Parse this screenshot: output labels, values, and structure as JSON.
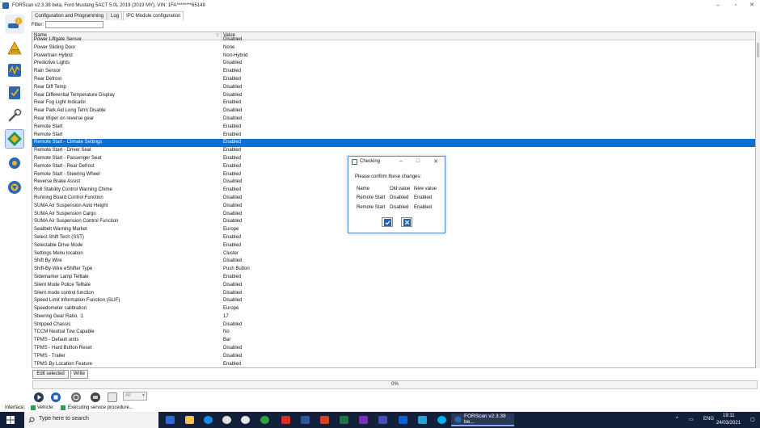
{
  "window": {
    "title": "FORScan v2.3.38 beta, Ford Mustang 5ACT 5.0L 2019 (2019 MY), VIN: 1FA********65149",
    "controls": [
      "–",
      "▫",
      "✕"
    ]
  },
  "sidebar": {
    "buttons": [
      {
        "name": "vehicle-info",
        "color": "#2a67b1"
      },
      {
        "name": "dtc",
        "color": "#e8a21a"
      },
      {
        "name": "oscilloscope",
        "color": "#2a67b1"
      },
      {
        "name": "checklist",
        "color": "#2a67b1"
      },
      {
        "name": "service-wrench",
        "color": "#555555"
      },
      {
        "name": "configuration",
        "color": "#1d9a5b"
      },
      {
        "name": "settings",
        "color": "#2a67b1"
      },
      {
        "name": "about",
        "color": "#2a67b1"
      }
    ]
  },
  "tabs": [
    {
      "label": "Configuration and Programming",
      "active": false
    },
    {
      "label": "Log",
      "active": false
    },
    {
      "label": "IPC Module configuration",
      "active": true
    }
  ],
  "filter": {
    "label": "Filter:",
    "value": ""
  },
  "grid": {
    "columns": [
      "Name",
      "Value"
    ],
    "rows": [
      {
        "name": "Power Liftgate Sensor",
        "value": "Disabled"
      },
      {
        "name": "Power Sliding Door",
        "value": "None"
      },
      {
        "name": "Powertrain Hybrid",
        "value": "Non-Hybrid"
      },
      {
        "name": "Predictive Lights",
        "value": "Disabled"
      },
      {
        "name": "Rain Sensor",
        "value": "Enabled"
      },
      {
        "name": "Rear Defrost",
        "value": "Enabled"
      },
      {
        "name": "Rear Diff Temp",
        "value": "Disabled"
      },
      {
        "name": "Rear Differential Temperature Display",
        "value": "Disabled"
      },
      {
        "name": "Rear Fog Light Indicator",
        "value": "Enabled"
      },
      {
        "name": "Rear Park Aid Long Term Disable",
        "value": "Disabled"
      },
      {
        "name": "Rear Wiper on reverse gear",
        "value": "Disabled"
      },
      {
        "name": "Remote Start",
        "value": "Enabled"
      },
      {
        "name": "Remote Start",
        "value": "Enabled"
      },
      {
        "name": "Remote Start - Climate Settings",
        "value": "Enabled",
        "selected": true
      },
      {
        "name": "Remote Start - Driver Seat",
        "value": "Enabled"
      },
      {
        "name": "Remote Start - Passenger Seat",
        "value": "Enabled"
      },
      {
        "name": "Remote Start - Rear Defrost",
        "value": "Enabled"
      },
      {
        "name": "Remote Start - Steering Wheel",
        "value": "Enabled"
      },
      {
        "name": "Reverse Brake Assist",
        "value": "Disabled"
      },
      {
        "name": "Roll Stability Control Warning Chime",
        "value": "Enabled"
      },
      {
        "name": "Running Board Control Function",
        "value": "Disabled"
      },
      {
        "name": "SUMA Air Suspension Auto Height",
        "value": "Disabled"
      },
      {
        "name": "SUMA Air Suspension Cargo",
        "value": "Disabled"
      },
      {
        "name": "SUMA Air Suspension Control Function",
        "value": "Disabled"
      },
      {
        "name": "Seatbelt Warning Market",
        "value": "Europe"
      },
      {
        "name": "Select Shift Tech (SST)",
        "value": "Enabled"
      },
      {
        "name": "Selectable Drive Mode",
        "value": "Enabled"
      },
      {
        "name": "Settings Menu location",
        "value": "Cluster"
      },
      {
        "name": "Shift By Wire",
        "value": "Disabled"
      },
      {
        "name": "Shift-By-Wire eShifter Type",
        "value": "Push Button"
      },
      {
        "name": "Sidemarker Lamp Telltale",
        "value": "Enabled"
      },
      {
        "name": "Silent Mode Police Telltale",
        "value": "Disabled"
      },
      {
        "name": "Silent mode control function",
        "value": "Disabled"
      },
      {
        "name": "Speed Limit Information Function (SLIF)",
        "value": "Disabled"
      },
      {
        "name": "Speedometer calibration",
        "value": "Europe"
      },
      {
        "name": "Steering Gear Ratio, :1",
        "value": "17"
      },
      {
        "name": "Stripped Chassis",
        "value": "Disabled"
      },
      {
        "name": "TCCM Neutral Tow Capable",
        "value": "No"
      },
      {
        "name": "TPMS - Default units",
        "value": "Bar"
      },
      {
        "name": "TPMS - Hard Button Reset",
        "value": "Disabled"
      },
      {
        "name": "TPMS - Trailer",
        "value": "Disabled"
      },
      {
        "name": "TPMS By Location Feature",
        "value": "Enabled"
      }
    ]
  },
  "actions": {
    "edit_selected": "Edit selected",
    "write": "Write"
  },
  "progress": {
    "text": "0%",
    "value": 0
  },
  "toolbar": {
    "loglevel": "All"
  },
  "status": {
    "interface_label": "Interface:",
    "vehicle_label": "Vehicle:",
    "message": "Executing service procedure...",
    "indicator_color": "#2e9c52"
  },
  "dialog": {
    "title": "Checking",
    "controls": [
      "–",
      "□",
      "✕"
    ],
    "message": "Please confirm these changes:",
    "headers": [
      "Name",
      "Old value",
      "New value"
    ],
    "rows": [
      {
        "name": "Remote Start",
        "old": "Disabled",
        "new": "Enabled"
      },
      {
        "name": "Remote Start",
        "old": "Disabled",
        "new": "Enabled"
      }
    ]
  },
  "taskbar": {
    "search_placeholder": "Type here to search",
    "active_app": "FORScan v2.3.38 be...",
    "language": "ENG",
    "time": "19:11",
    "date": "24/03/2021"
  }
}
